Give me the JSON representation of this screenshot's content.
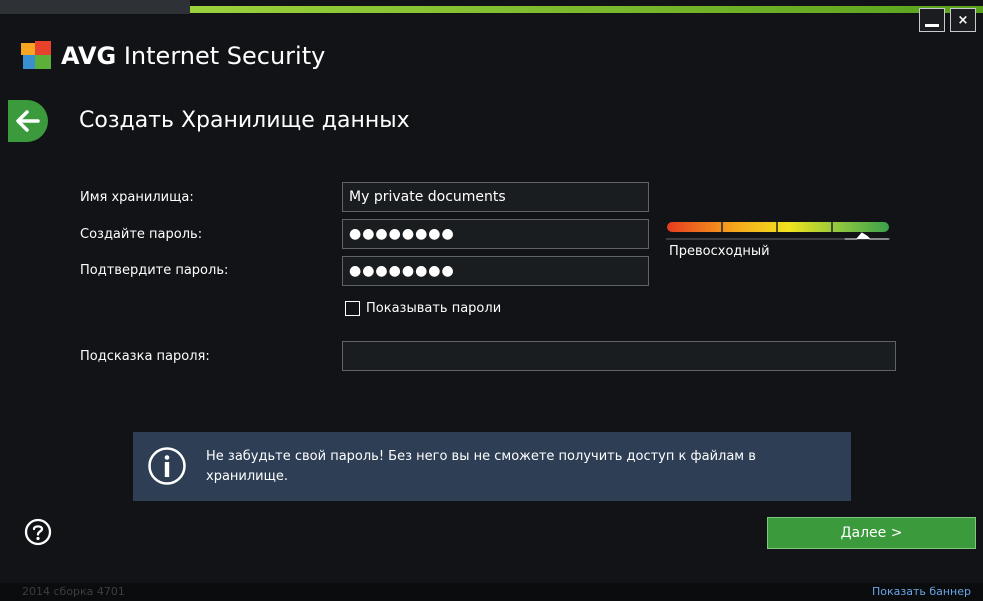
{
  "window": {
    "brand_avg": "AVG",
    "brand_rest": " Internet Security",
    "minimize_label": "",
    "close_label": "×"
  },
  "page": {
    "title": "Создать Хранилище данных"
  },
  "form": {
    "vault_name_label": "Имя хранилища:",
    "vault_name_value": "My private documents",
    "create_password_label": "Создайте пароль:",
    "create_password_mask": "●●●●●●●●",
    "confirm_password_label": "Подтвердите пароль:",
    "confirm_password_mask": "●●●●●●●●",
    "show_passwords_label": "Показывать пароли",
    "show_passwords_checked": false,
    "password_hint_label": "Подсказка пароля:",
    "password_hint_value": ""
  },
  "strength": {
    "label": "Превосходный",
    "level": 0.9,
    "colors": [
      "#e53b1f",
      "#f7a51b",
      "#f0e41e",
      "#8dc63f",
      "#3aa04a"
    ]
  },
  "info": {
    "message": "Не забудьте свой пароль! Без него вы не сможете получить доступ к файлам в хранилище."
  },
  "actions": {
    "next_label": "Далее >"
  },
  "status": {
    "build": "2014  сборка 4701",
    "show_banner": "Показать баннер"
  },
  "colors": {
    "background": "#111316",
    "accent_green": "#3a9a3c",
    "info_bg": "#2d3e55",
    "link": "#6aa5e6"
  }
}
